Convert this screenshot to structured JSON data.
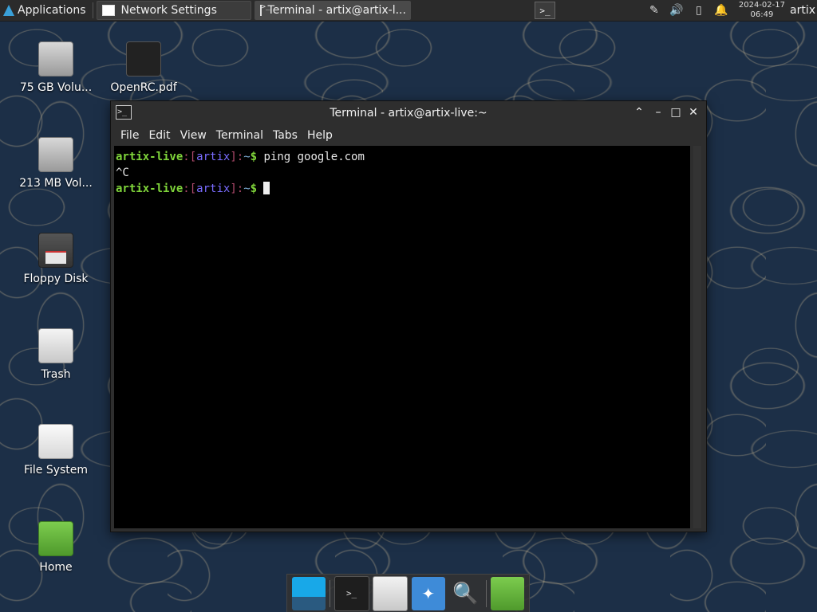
{
  "top_panel": {
    "applications_label": "Applications",
    "tasks": [
      {
        "label": "Network Settings"
      },
      {
        "label": "Terminal - artix@artix-l..."
      }
    ],
    "clock_date": "2024-02-17",
    "clock_time": "06:49",
    "user": "artix"
  },
  "desktop": {
    "icons": [
      {
        "label": "75 GB Volu..."
      },
      {
        "label": "OpenRC.pdf"
      },
      {
        "label": "213 MB Vol..."
      },
      {
        "label": "Floppy Disk"
      },
      {
        "label": "Trash"
      },
      {
        "label": "File System"
      },
      {
        "label": "Home"
      }
    ]
  },
  "terminal": {
    "title": "Terminal - artix@artix-live:~",
    "menu": [
      "File",
      "Edit",
      "View",
      "Terminal",
      "Tabs",
      "Help"
    ],
    "prompt_host": "artix-live",
    "prompt_user": "artix",
    "prompt_path": "~",
    "command1": "ping google.com",
    "output1": "^C"
  }
}
